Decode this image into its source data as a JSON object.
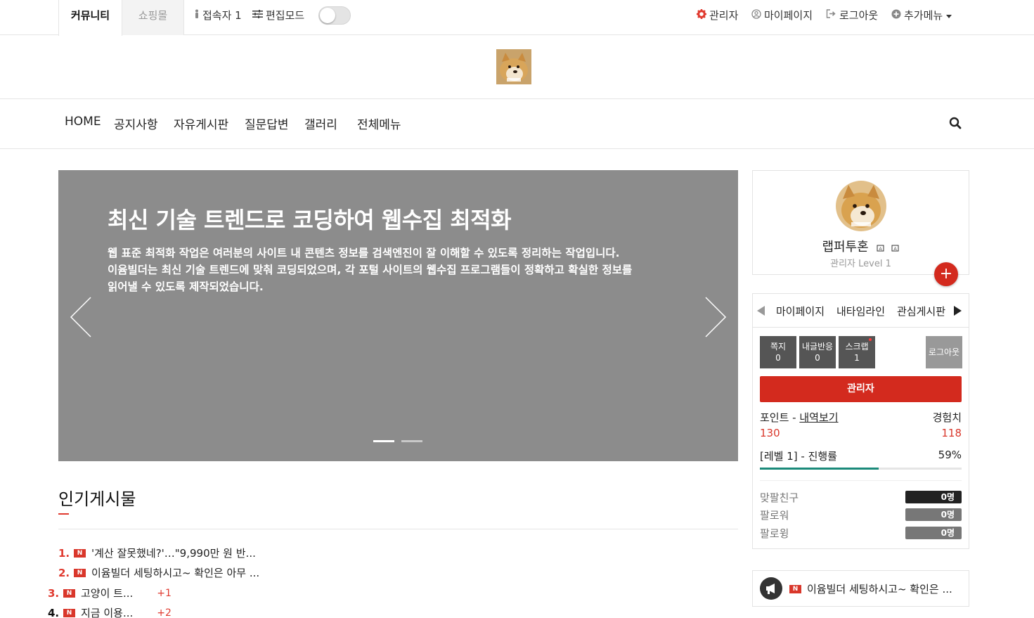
{
  "topbar": {
    "tab_community": "커뮤니티",
    "tab_shop": "쇼핑몰",
    "visitors_label": "접속자 1",
    "edit_mode_label": "편집모드",
    "edit_mode_on": false,
    "admin_label": "관리자",
    "mypage_label": "마이페이지",
    "logout_label": "로그아웃",
    "more_label": "추가메뉴"
  },
  "nav": {
    "items": [
      "HOME",
      "공지사항",
      "자유게시판",
      "질문답변",
      "갤러리",
      "전체메뉴"
    ]
  },
  "slider": {
    "title": "최신 기술 트렌드로 코딩하여 웹수집 최적화",
    "desc_line1": "웹 표준 최적화 작업은 여러분의 사이트 내 콘텐츠 정보를 검색엔진이 잘 이해할 수 있도록 정리하는 작업입니다.",
    "desc_line2": "이윰빌더는 최신 기술 트렌드에 맞춰 코딩되었으며, 각 포털 사이트의 웹수집 프로그램들이 정확하고 확실한 정보를",
    "desc_line3": "읽어낼 수 있도록 제작되었습니다.",
    "slide_count": 2,
    "active_slide": 1,
    "background": "#8c8c8c"
  },
  "popular": {
    "title": "인기게시물",
    "posts": [
      {
        "rank": "1.",
        "title": "'계산 잘못했네?'…\"9,990만 원 반...",
        "count": ""
      },
      {
        "rank": "2.",
        "title": "이윰빌더 세팅하시고~ 확인은 아무 ...",
        "count": ""
      },
      {
        "rank": "3.",
        "title": "고양이 트...",
        "count": "+1"
      },
      {
        "rank": "4.",
        "title": "지금 이용...",
        "count": "+2"
      }
    ],
    "badge": "N"
  },
  "profile": {
    "nickname": "랩퍼투혼",
    "level_text": "관리자 Level 1",
    "plus": "+"
  },
  "member_menu": {
    "tabs": [
      "마이페이지",
      "내타임라인",
      "관심게시판"
    ],
    "stats": [
      {
        "label": "쪽지",
        "value": "0"
      },
      {
        "label": "내글반응",
        "value": "0"
      },
      {
        "label": "스크랩",
        "value": "1"
      }
    ],
    "logout_label": "로그아웃",
    "admin_label": "관리자",
    "point_label": "포인트 - ",
    "point_link": "내역보기",
    "exp_label": "경험치",
    "point_value": "130",
    "exp_value": "118",
    "level_label": "[레벨 1] - 진행률",
    "progress_text": "59%",
    "progress": 0.59,
    "relations": [
      {
        "label": "맞팔친구",
        "value": "0명",
        "color": "#222222"
      },
      {
        "label": "팔로워",
        "value": "0명",
        "color": "#777777"
      },
      {
        "label": "팔로윙",
        "value": "0명",
        "color": "#777777"
      }
    ]
  },
  "notice": {
    "text": "이윰빌더 세팅하시고~ 확인은 ..."
  },
  "colors": {
    "accent": "#d32a1e",
    "progress": "#1b8a7a"
  }
}
